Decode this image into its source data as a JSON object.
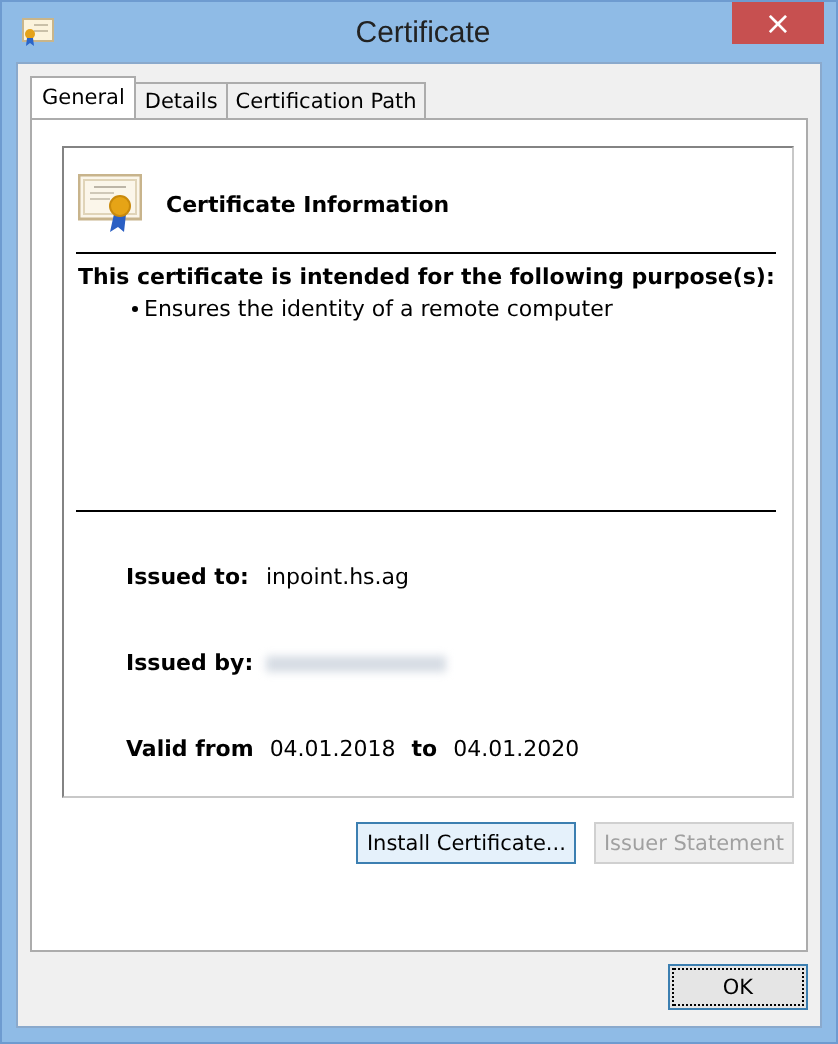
{
  "window": {
    "title": "Certificate",
    "close": "×"
  },
  "tabs": [
    {
      "label": "General",
      "selected": true
    },
    {
      "label": "Details",
      "selected": false
    },
    {
      "label": "Certification Path",
      "selected": false
    }
  ],
  "info": {
    "heading": "Certificate Information",
    "purpose_heading": "This certificate is intended for the following purpose(s):",
    "purposes": [
      "Ensures the identity of a remote computer"
    ],
    "issued_to_label": "Issued to:",
    "issued_to": "inpoint.hs.ag",
    "issued_by_label": "Issued by:",
    "issued_by_redacted": true,
    "valid_from_label": "Valid from",
    "valid_from": "04.01.2018",
    "valid_to_label": "to",
    "valid_to": "04.01.2020"
  },
  "panel_buttons": [
    {
      "label": "Install Certificate...",
      "disabled": false,
      "highlighted": true
    },
    {
      "label": "Issuer Statement",
      "disabled": true,
      "highlighted": false
    }
  ],
  "ok_button": {
    "label": "OK",
    "focused": true
  }
}
